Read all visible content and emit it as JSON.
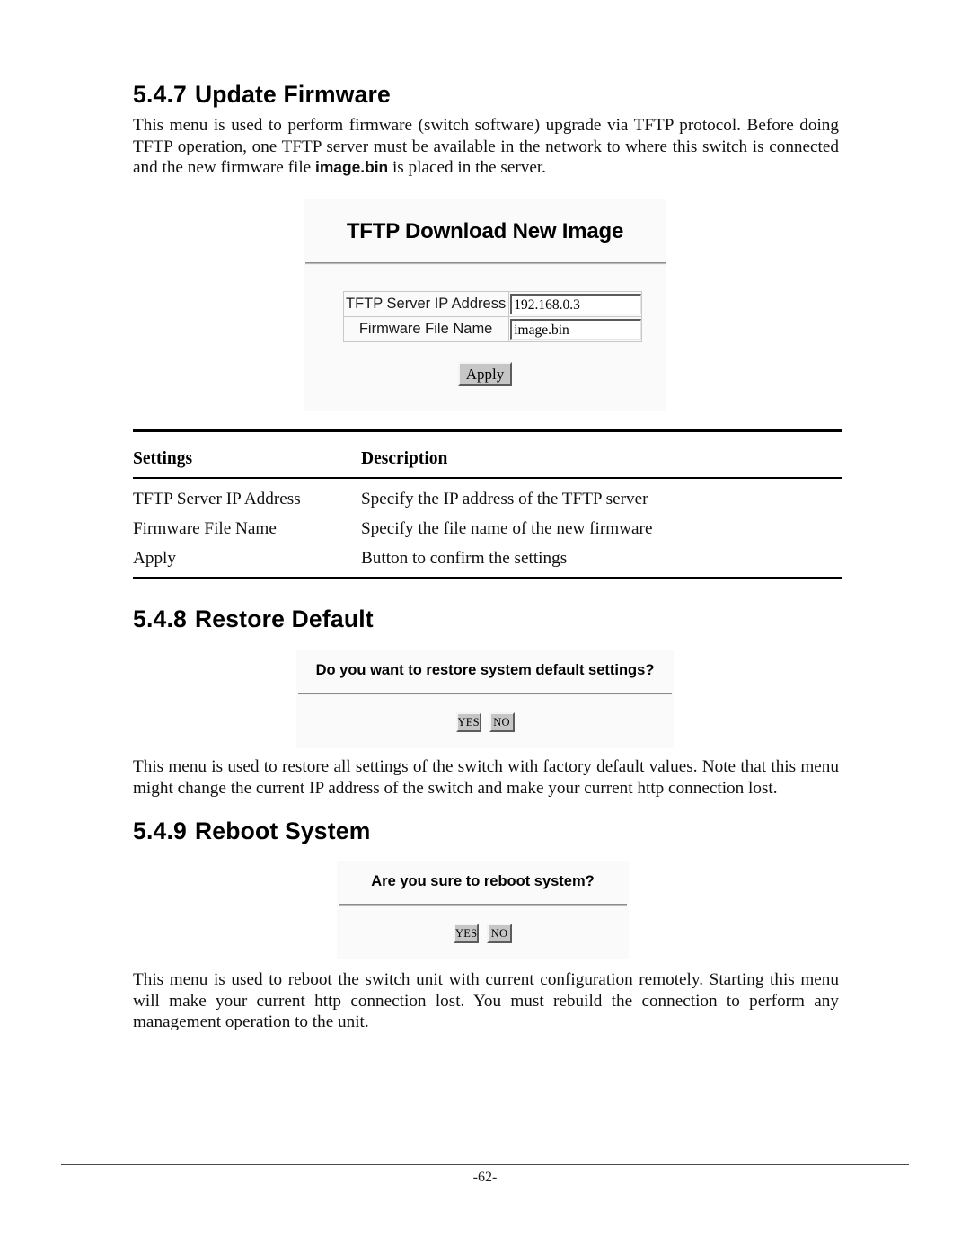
{
  "document": {
    "page_number": "-62-"
  },
  "sections": {
    "update_firmware": {
      "number": "5.4.7",
      "title": "Update Firmware",
      "paragraph_part1": "This menu is used to perform firmware (switch software) upgrade via TFTP protocol. Before doing TFTP operation, one TFTP server must be available in the network to where this switch is connected and the new firmware file ",
      "paragraph_bold": "image.bin",
      "paragraph_part2": " is placed in the server."
    },
    "restore_default": {
      "number": "5.4.8",
      "title": "Restore Default",
      "paragraph": "This menu is used to restore all settings of the switch with factory default values. Note that this menu might change the current IP address of the switch and make your current http connection lost."
    },
    "reboot_system": {
      "number": "5.4.9",
      "title": "Reboot System",
      "paragraph": "This menu is used to reboot the switch unit with current configuration remotely. Starting this menu will make your current http connection lost. You must rebuild the connection to perform any management operation to the unit."
    }
  },
  "tftp_dialog": {
    "title": "TFTP Download New Image",
    "fields": [
      {
        "label": "TFTP Server IP Address",
        "value": "192.168.0.3"
      },
      {
        "label": "Firmware File Name",
        "value": "image.bin"
      }
    ],
    "apply_button": "Apply"
  },
  "settings_table": {
    "headers": {
      "settings": "Settings",
      "description": "Description"
    },
    "rows": [
      {
        "setting": "TFTP Server IP Address",
        "description": "Specify the IP address of the TFTP server"
      },
      {
        "setting": "Firmware File Name",
        "description": "Specify the file name of the new firmware"
      },
      {
        "setting": "Apply",
        "description": "Button to confirm the settings"
      }
    ]
  },
  "restore_dialog": {
    "question": "Do you want to restore system default settings?",
    "yes_button": "YES",
    "no_button": "NO"
  },
  "reboot_dialog": {
    "question": "Are you sure to reboot system?",
    "yes_button": "YES",
    "no_button": "NO"
  }
}
